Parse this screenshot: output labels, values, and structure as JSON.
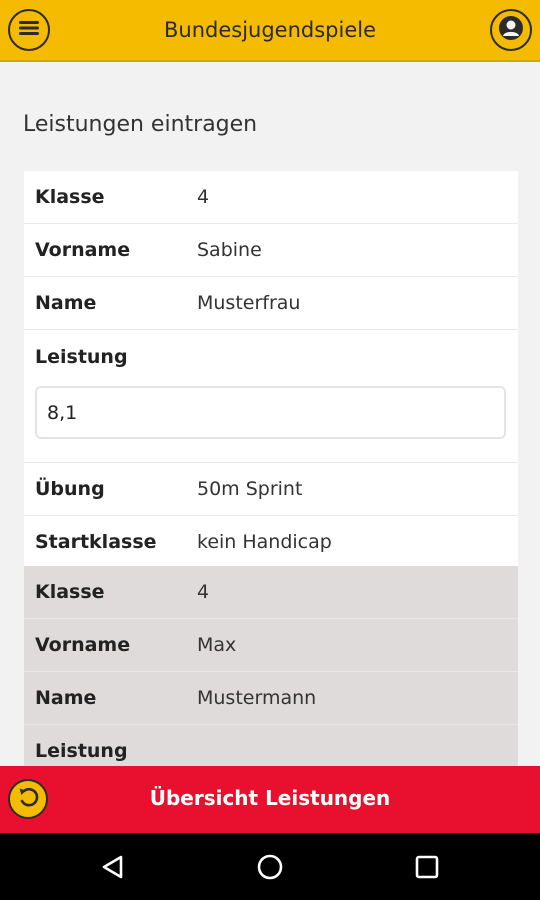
{
  "app": {
    "title": "Bundesjugendspiele"
  },
  "page": {
    "heading": "Leistungen eintragen"
  },
  "entry1": {
    "klasse_label": "Klasse",
    "klasse_value": "4",
    "vorname_label": "Vorname",
    "vorname_value": "Sabine",
    "name_label": "Name",
    "name_value": "Musterfrau",
    "leistung_label": "Leistung",
    "leistung_value": "8,1",
    "uebung_label": "Übung",
    "uebung_value": "50m Sprint",
    "startklasse_label": "Startklasse",
    "startklasse_value": "kein Handicap"
  },
  "entry2": {
    "klasse_label": "Klasse",
    "klasse_value": "4",
    "vorname_label": "Vorname",
    "vorname_value": "Max",
    "name_label": "Name",
    "name_value": "Mustermann",
    "leistung_label": "Leistung"
  },
  "bottom": {
    "label": "Übersicht Leistungen"
  },
  "icons": {
    "menu": "menu-icon",
    "user": "user-icon",
    "back": "undo-arrow-icon",
    "nav_back": "triangle-back-icon",
    "nav_home": "circle-home-icon",
    "nav_recents": "square-recents-icon"
  },
  "colors": {
    "appbar": "#f5bb00",
    "bottom_bar": "#e8102e",
    "card_highlight": "#dfdbdb"
  }
}
